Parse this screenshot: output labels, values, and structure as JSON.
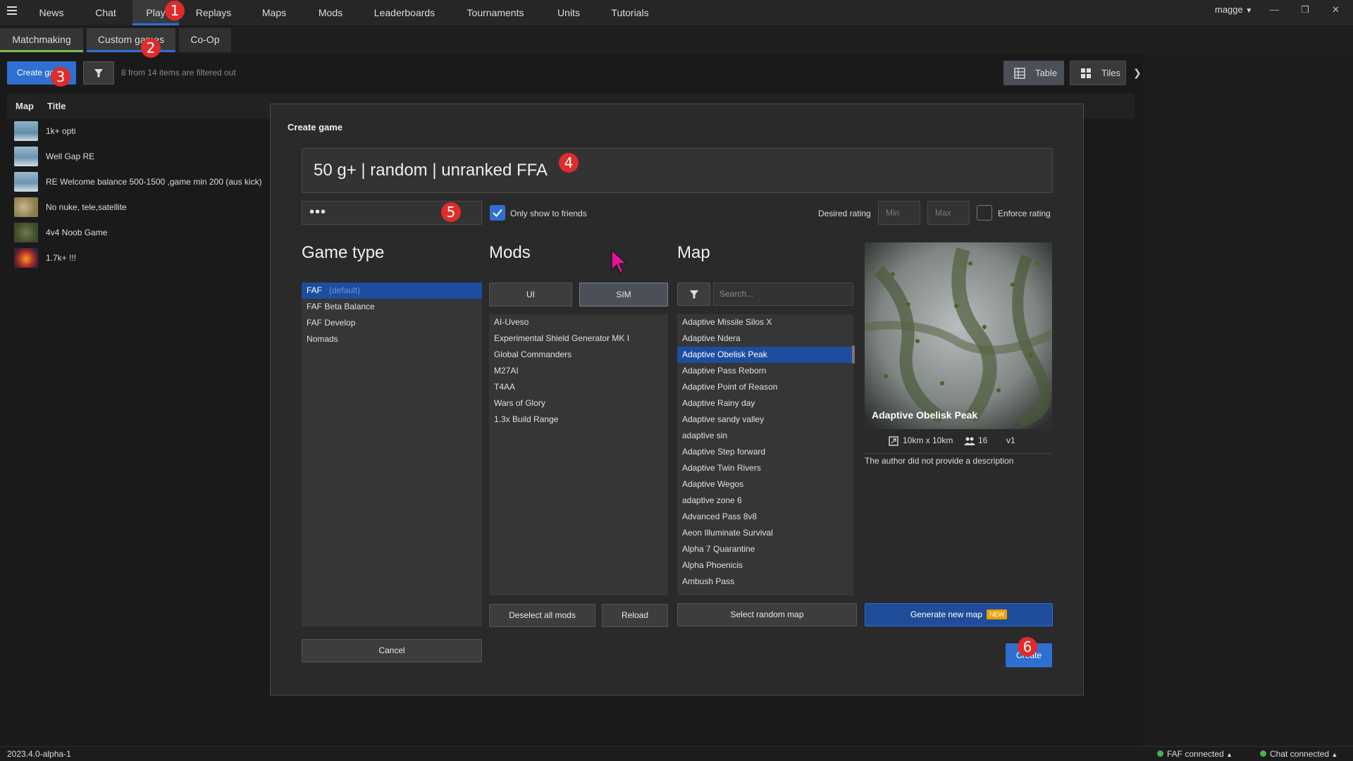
{
  "nav": {
    "tabs": [
      "News",
      "Chat",
      "Play",
      "Replays",
      "Maps",
      "Mods",
      "Leaderboards",
      "Tournaments",
      "Units",
      "Tutorials"
    ],
    "active": "Play",
    "user": "magge"
  },
  "subnav": {
    "tabs": [
      "Matchmaking",
      "Custom games",
      "Co-Op"
    ]
  },
  "toolbar": {
    "create_label": "Create game",
    "filter_info": "8 from 14 items are filtered out",
    "table_label": "Table",
    "tiles_label": "Tiles"
  },
  "list": {
    "headers": [
      "Map",
      "Title"
    ],
    "games": [
      {
        "title": "1k+ opti"
      },
      {
        "title": "Well Gap RE"
      },
      {
        "title": "RE Welcome balance 500-1500 ,game min 200 (aus kick)"
      },
      {
        "title": "No nuke, tele,satellite"
      },
      {
        "title": "4v4 Noob Game"
      },
      {
        "title": "1.7k+ !!!"
      }
    ]
  },
  "dialog": {
    "title": "Create game",
    "game_title": "50 g+ | random | unranked FFA",
    "password": "•••",
    "only_friends_label": "Only show to friends",
    "only_friends_checked": true,
    "desired_rating_label": "Desired rating",
    "min_placeholder": "Min",
    "max_placeholder": "Max",
    "enforce_rating_label": "Enforce rating",
    "game_type_title": "Game type",
    "mods_title": "Mods",
    "map_title": "Map",
    "game_types": [
      {
        "name": "FAF",
        "tag": "(default)",
        "selected": true
      },
      {
        "name": "FAF Beta Balance"
      },
      {
        "name": "FAF Develop"
      },
      {
        "name": "Nomads"
      }
    ],
    "mods_tabs": [
      "UI",
      "SIM"
    ],
    "mods_selected_tab": "SIM",
    "mods": [
      "AI-Uveso",
      "Experimental Shield Generator MK I",
      "Global Commanders",
      "M27AI",
      "T4AA",
      "Wars of Glory",
      "1.3x Build Range"
    ],
    "map_search_placeholder": "Search...",
    "maps": [
      "Adaptive Missile Silos X",
      "Adaptive Ndera",
      "Adaptive Obelisk Peak",
      "Adaptive Pass Reborn",
      "Adaptive Point of Reason",
      "Adaptive Rainy day",
      "Adaptive sandy valley",
      "adaptive sin",
      "Adaptive Step forward",
      "Adaptive Twin Rivers",
      "Adaptive Wegos",
      "adaptive zone 6",
      "Advanced Pass 8v8",
      "Aeon Illuminate Survival",
      "Alpha 7 Quarantine",
      "Alpha Phoenicis",
      "Ambush Pass"
    ],
    "selected_map": "Adaptive Obelisk Peak",
    "preview": {
      "name": "Adaptive Obelisk Peak",
      "size": "10km x 10km",
      "players": "16",
      "version": "v1",
      "description": "The author did not provide a description"
    },
    "buttons": {
      "deselect_mods": "Deselect all mods",
      "reload": "Reload",
      "random_map": "Select random map",
      "generate_map": "Generate new map",
      "new_badge": "NEW",
      "cancel": "Cancel",
      "create": "Create"
    }
  },
  "annotations": [
    "1",
    "2",
    "3",
    "4",
    "5",
    "6"
  ],
  "status": {
    "version": "2023.4.0-alpha-1",
    "faf": "FAF connected",
    "chat": "Chat connected"
  },
  "colors": {
    "accent": "#2f6fd1",
    "selection": "#1d4d9f",
    "badge": "#e02b2b",
    "status_ok": "#4caf50"
  }
}
